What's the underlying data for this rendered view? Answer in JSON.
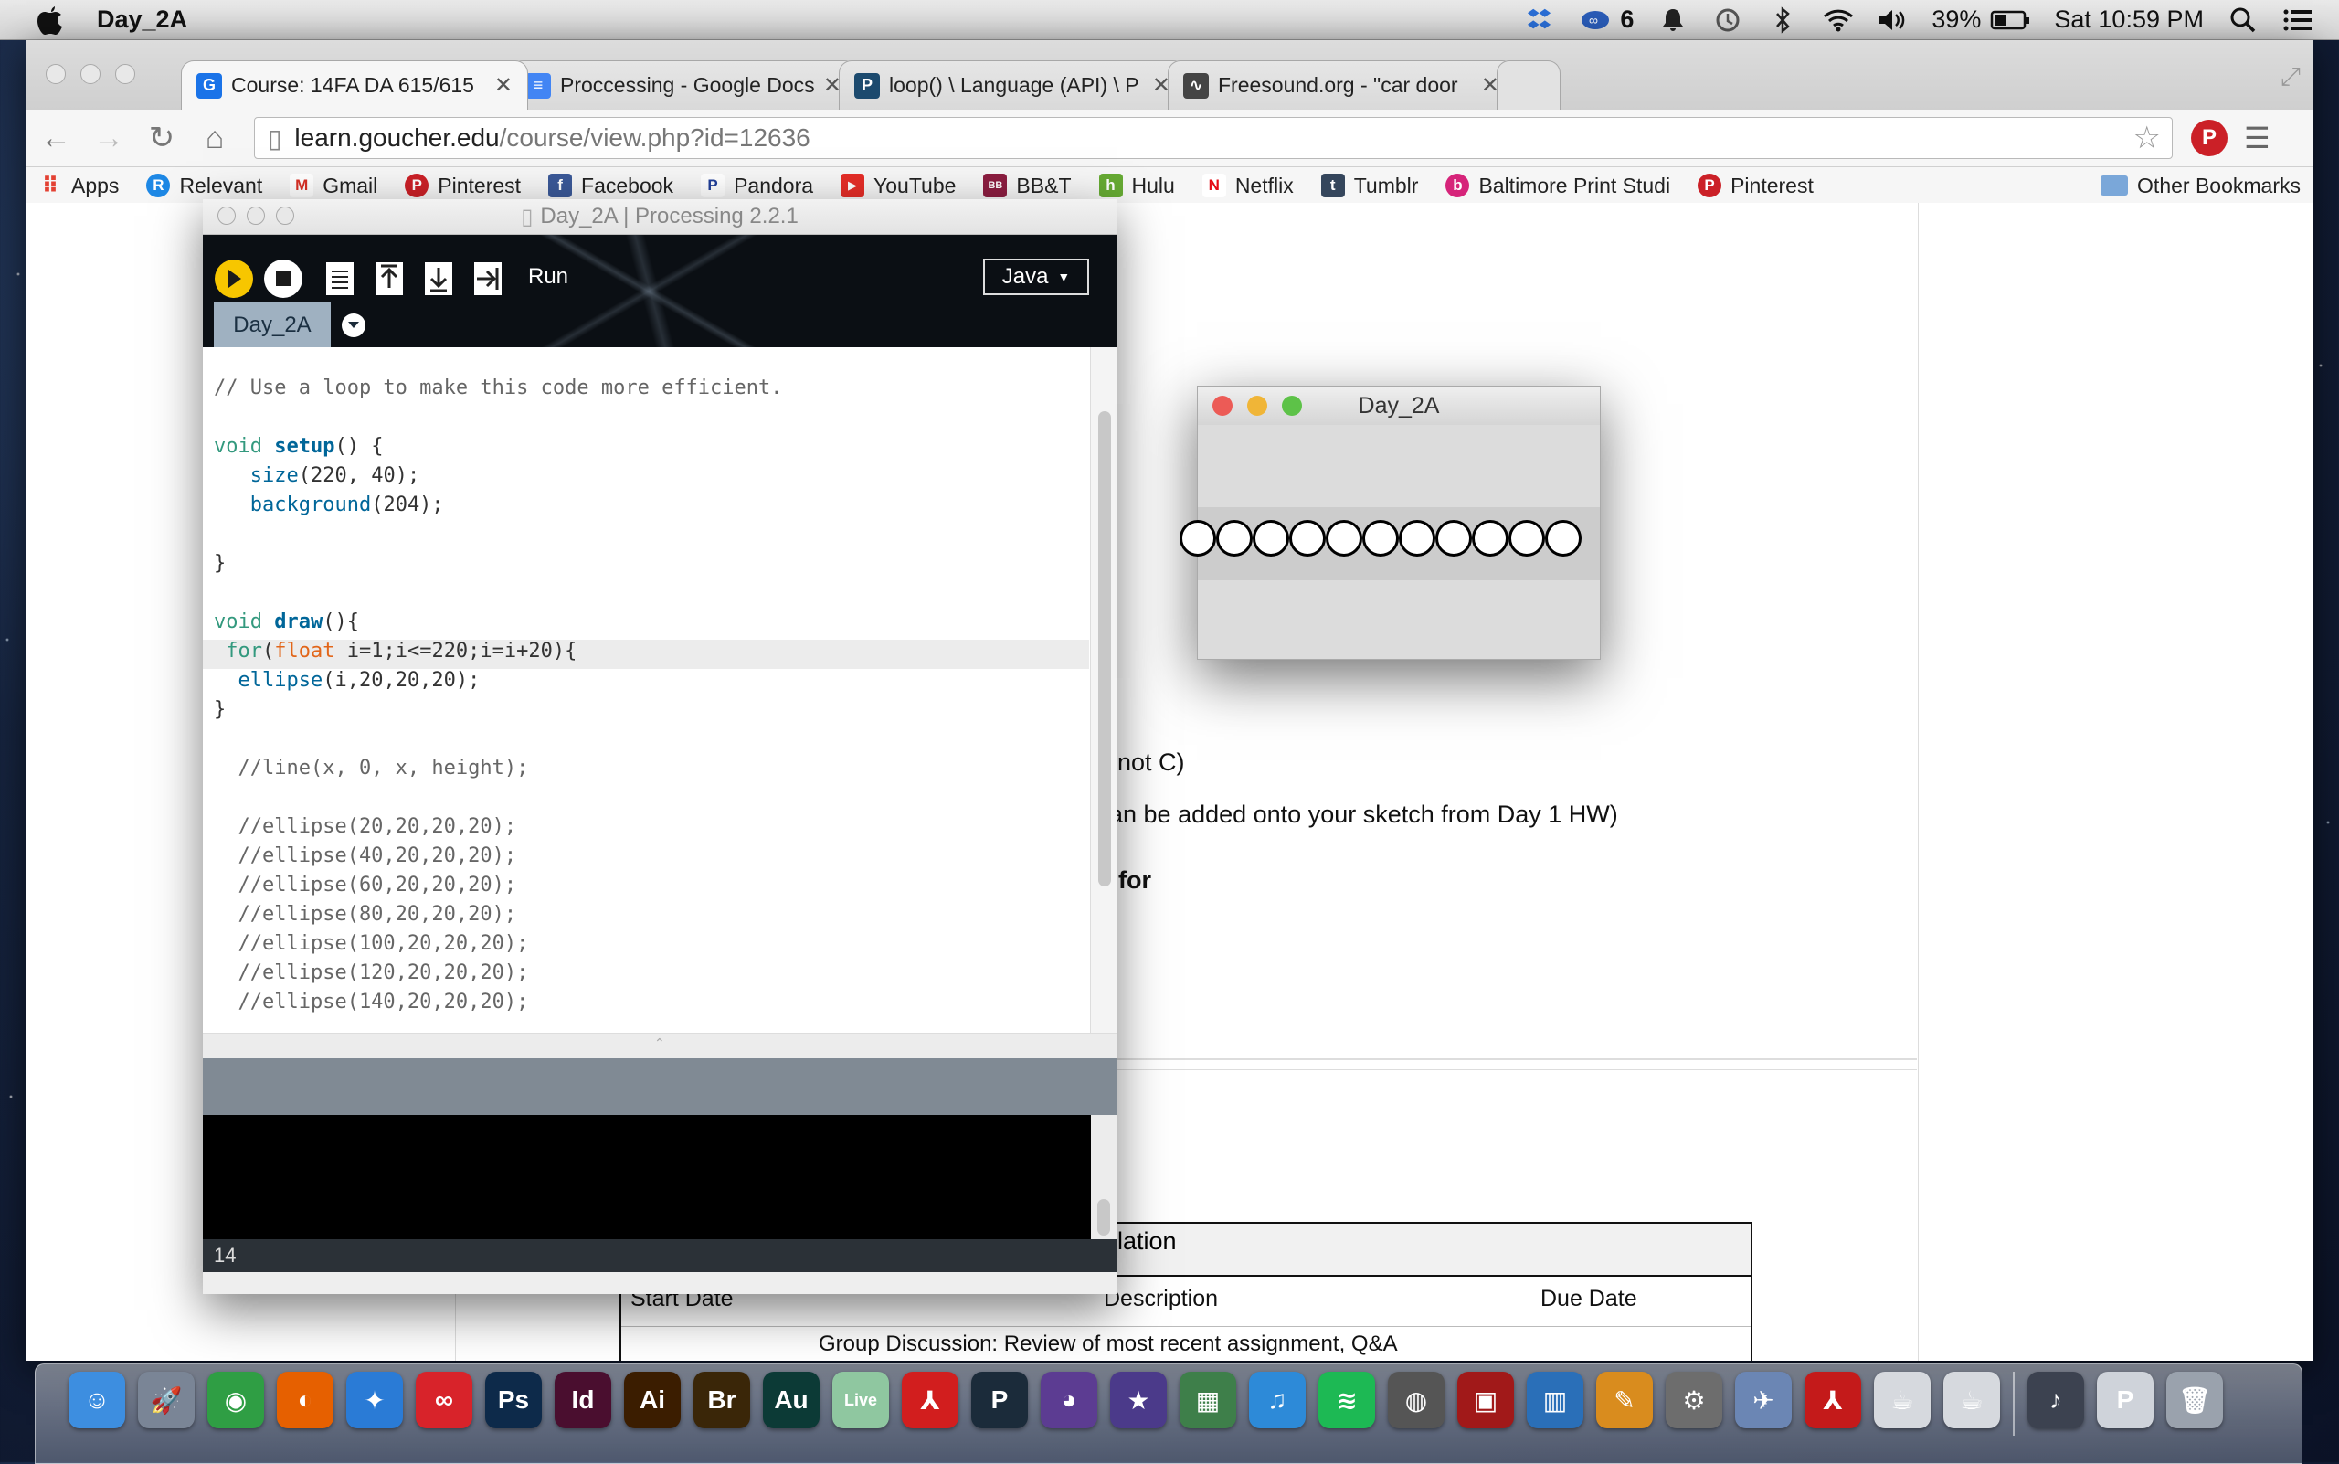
{
  "menubar": {
    "app_name": "Day_2A",
    "notification_count": "6",
    "battery": "39%",
    "clock": "Sat 10:59 PM"
  },
  "browser": {
    "tabs": [
      {
        "label": "Course: 14FA DA 615/615",
        "favicon": "G",
        "color": "#1a73e8"
      },
      {
        "label": "Proccessing - Google Docs",
        "favicon": "≡",
        "color": "#4285f4"
      },
      {
        "label": "loop() \\ Language (API) \\ P",
        "favicon": "P",
        "color": "#1c4a6e"
      },
      {
        "label": "Freesound.org - \"car door",
        "favicon": "∿",
        "color": "#444444"
      }
    ],
    "url_domain": "learn.goucher.edu",
    "url_path": "/course/view.php?id=12636",
    "bookmarks": [
      {
        "label": "Apps",
        "icon": "apps-icon",
        "color": "#e34133"
      },
      {
        "label": "Relevant",
        "icon": "R",
        "color": "#1e88e5"
      },
      {
        "label": "Gmail",
        "icon": "M",
        "color": "#d93025"
      },
      {
        "label": "Pinterest",
        "icon": "P",
        "color": "#cb2027"
      },
      {
        "label": "Facebook",
        "icon": "f",
        "color": "#3b5998"
      },
      {
        "label": "Pandora",
        "icon": "P",
        "color": "#224099"
      },
      {
        "label": "YouTube",
        "icon": "▶",
        "color": "#e52d27"
      },
      {
        "label": "BB&T",
        "icon": "B",
        "color": "#8c1d40"
      },
      {
        "label": "Hulu",
        "icon": "h",
        "color": "#66aa33"
      },
      {
        "label": "Netflix",
        "icon": "N",
        "color": "#e50914"
      },
      {
        "label": "Tumblr",
        "icon": "t",
        "color": "#35465c"
      },
      {
        "label": "Baltimore Print Studi",
        "icon": "b",
        "color": "#d6247a"
      },
      {
        "label": "Pinterest",
        "icon": "P",
        "color": "#cb2027"
      }
    ],
    "other_bookmarks": "Other Bookmarks"
  },
  "page": {
    "text1": "(not C)",
    "text2": "an be added onto your sketch from Day 1 HW)",
    "text3": "for",
    "table_title": "ulation",
    "col_start": "Start Date",
    "col_desc": "Description",
    "col_due": "Due Date",
    "row_partial": "Group Discussion: Review of most recent assignment, Q&A"
  },
  "processing": {
    "title": "Day_2A | Processing 2.2.1",
    "run_label": "Run",
    "mode": "Java",
    "sketch_tab": "Day_2A",
    "line_number": "14",
    "code": {
      "l1": "// Use a loop to make this code more efficient.",
      "l3a": "void ",
      "l3b": "setup",
      "l3c": "() {",
      "l4a": "   ",
      "l4b": "size",
      "l4c": "(220, 40);",
      "l5a": "   ",
      "l5b": "background",
      "l5c": "(204);",
      "l7": "}",
      "l9a": "void ",
      "l9b": "draw",
      "l9c": "(){",
      "l10a": " ",
      "l10b": "for",
      "l10c": "(",
      "l10d": "float",
      "l10e": " i=1;i<=220;i=i+20){",
      "l11a": "  ",
      "l11b": "ellipse",
      "l11c": "(i,20,20,20);",
      "l12": "}",
      "l14": "  //line(x, 0, x, height);",
      "l16": "  //ellipse(20,20,20,20);",
      "l17": "  //ellipse(40,20,20,20);",
      "l18": "  //ellipse(60,20,20,20);",
      "l19": "  //ellipse(80,20,20,20);",
      "l20": "  //ellipse(100,20,20,20);",
      "l21": "  //ellipse(120,20,20,20);",
      "l22": "  //ellipse(140,20,20,20);"
    }
  },
  "sketch_window": {
    "title": "Day_2A",
    "circle_count": 11
  },
  "dock": [
    {
      "name": "finder-icon",
      "glyph": "☺",
      "color": "#3d8ee0"
    },
    {
      "name": "launchpad-icon",
      "glyph": "🚀",
      "color": "#7a8596"
    },
    {
      "name": "chrome-icon",
      "glyph": "◉",
      "color": "#2f9e44"
    },
    {
      "name": "firefox-icon",
      "glyph": "◐",
      "color": "#e66000"
    },
    {
      "name": "safari-icon",
      "glyph": "✦",
      "color": "#2a7bd6"
    },
    {
      "name": "creative-cloud-icon",
      "glyph": "∞",
      "color": "#d8232a"
    },
    {
      "name": "photoshop-icon",
      "glyph": "Ps",
      "color": "#0d2a4a"
    },
    {
      "name": "indesign-icon",
      "glyph": "Id",
      "color": "#4a0e2f"
    },
    {
      "name": "illustrator-icon",
      "glyph": "Ai",
      "color": "#3b1d00"
    },
    {
      "name": "bridge-icon",
      "glyph": "Br",
      "color": "#3a2608"
    },
    {
      "name": "audition-icon",
      "glyph": "Au",
      "color": "#0c3a36"
    },
    {
      "name": "live-icon",
      "glyph": "Live",
      "color": "#8fc7a0"
    },
    {
      "name": "acrobat-icon",
      "glyph": "⅄",
      "color": "#d21e1e"
    },
    {
      "name": "processing-icon",
      "glyph": "P",
      "color": "#1b2b3a"
    },
    {
      "name": "github-icon",
      "glyph": "◕",
      "color": "#5c3c92"
    },
    {
      "name": "imovie-icon",
      "glyph": "★",
      "color": "#4b3a8a"
    },
    {
      "name": "iphoto-icon",
      "glyph": "▦",
      "color": "#3e7f4a"
    },
    {
      "name": "itunes-icon",
      "glyph": "♫",
      "color": "#2d8ad8"
    },
    {
      "name": "spotify-icon",
      "glyph": "≋",
      "color": "#1db954"
    },
    {
      "name": "facetime-icon",
      "glyph": "◍",
      "color": "#555555"
    },
    {
      "name": "photo-booth-icon",
      "glyph": "▣",
      "color": "#a11919"
    },
    {
      "name": "numbers-icon",
      "glyph": "▥",
      "color": "#2a6fb8"
    },
    {
      "name": "pages-icon",
      "glyph": "✎",
      "color": "#d98c1e"
    },
    {
      "name": "system-preferences-icon",
      "glyph": "⚙",
      "color": "#6d6d6d"
    },
    {
      "name": "preview-icon",
      "glyph": "✈",
      "color": "#6b86b4"
    },
    {
      "name": "adobe-reader-icon",
      "glyph": "⅄",
      "color": "#c41a1a"
    },
    {
      "name": "java-icon",
      "glyph": "☕",
      "color": "#d6d9de"
    },
    {
      "name": "java-2-icon",
      "glyph": "☕",
      "color": "#d6d9de"
    },
    {
      "name": "music-folder-icon",
      "glyph": "♪",
      "color": "#3c4250"
    },
    {
      "name": "processing-doc-icon",
      "glyph": "P",
      "color": "#cfd3da"
    },
    {
      "name": "trash-icon",
      "glyph": "🗑",
      "color": "#9aa2ad"
    }
  ]
}
